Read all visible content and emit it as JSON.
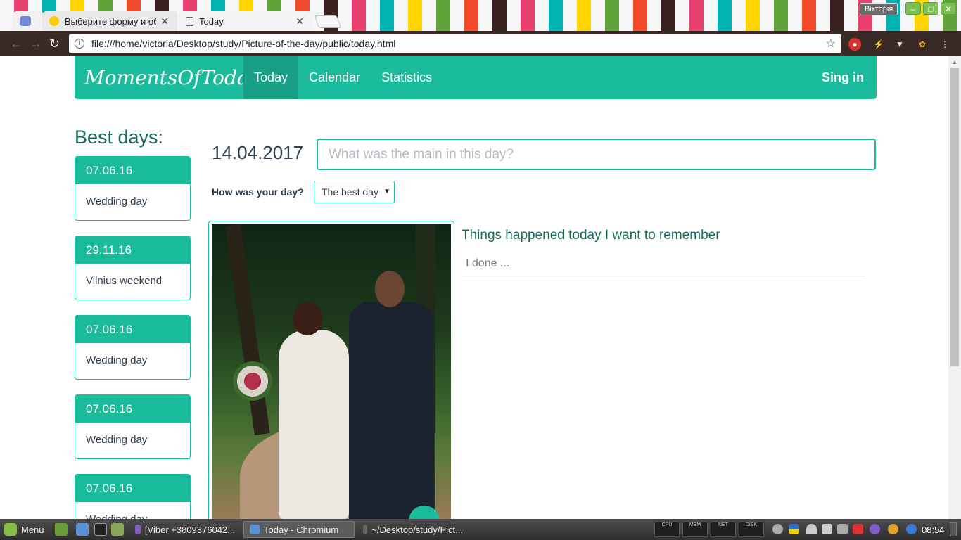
{
  "browser": {
    "tabs": [
      {
        "label": ""
      },
      {
        "label": "Выберите форму и об"
      },
      {
        "label": "Today"
      }
    ],
    "user_badge": "Вікторія",
    "url": "file:///home/victoria/Desktop/study/Picture-of-the-day/public/today.html"
  },
  "site": {
    "brand": "MomentsOfToday",
    "nav": {
      "today": "Today",
      "calendar": "Calendar",
      "statistics": "Statistics",
      "signin": "Sing in"
    },
    "best_days_title": "Best days:",
    "best_days": [
      {
        "date": "07.06.16",
        "name": "Wedding day"
      },
      {
        "date": "29.11.16",
        "name": "Vilnius weekend"
      },
      {
        "date": "07.06.16",
        "name": "Wedding day"
      },
      {
        "date": "07.06.16",
        "name": "Wedding day"
      },
      {
        "date": "07.06.16",
        "name": "Wedding day"
      }
    ],
    "day": {
      "date": "14.04.2017",
      "main_placeholder": "What was the main in this day?",
      "how_label": "How was your day?",
      "mood_selected": "The best day",
      "things_title": "Things happened today I want to remember",
      "things_placeholder": "I done ..."
    }
  },
  "taskbar": {
    "menu_label": "Menu",
    "tasks": [
      {
        "label": "[Viber +3809376042..."
      },
      {
        "label": "Today - Chromium"
      },
      {
        "label": "~/Desktop/study/Pict..."
      }
    ],
    "monitors": [
      "CPU",
      "MEM",
      "NET",
      "DISK"
    ],
    "clock": "08:54"
  },
  "colors": {
    "accent": "#1abc9c",
    "accent_dark": "#169f85",
    "heading": "#166a5b"
  }
}
